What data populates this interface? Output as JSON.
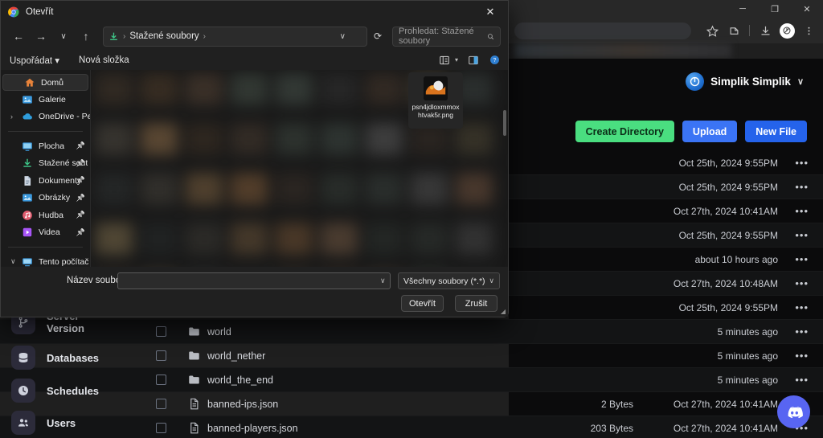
{
  "browser": {
    "window_controls": {
      "minimize": "─",
      "maximize": "❐",
      "close": "✕"
    },
    "toolbar_icons": [
      "bookmark-star-icon",
      "extensions-icon",
      "downloads-icon",
      "profile-icon",
      "chrome-menu-icon"
    ]
  },
  "panel": {
    "user": {
      "name": "Simplik Simplik",
      "chevron": "∨"
    },
    "actions": [
      {
        "label": "Create Directory",
        "color": "#4ade80",
        "text_color": "#0b2d17",
        "name": "create-directory-button"
      },
      {
        "label": "Upload",
        "color": "#3b74f5",
        "text_color": "#ffffff",
        "name": "upload-button"
      },
      {
        "label": "New File",
        "color": "#2563eb",
        "text_color": "#ffffff",
        "name": "new-file-button"
      }
    ],
    "sidebar": [
      {
        "label": "Server Version",
        "icon": "branch-icon"
      },
      {
        "label": "Databases",
        "icon": "database-icon"
      },
      {
        "label": "Schedules",
        "icon": "clock-icon"
      },
      {
        "label": "Users",
        "icon": "users-icon"
      }
    ],
    "files": [
      {
        "name": "",
        "type": "",
        "size": "",
        "modified": "Oct 25th, 2024 9:55PM",
        "menu": "•••"
      },
      {
        "name": "",
        "type": "",
        "size": "",
        "modified": "Oct 25th, 2024 9:55PM",
        "menu": "•••"
      },
      {
        "name": "",
        "type": "",
        "size": "",
        "modified": "Oct 27th, 2024 10:41AM",
        "menu": "•••"
      },
      {
        "name": "",
        "type": "",
        "size": "",
        "modified": "Oct 25th, 2024 9:55PM",
        "menu": "•••"
      },
      {
        "name": "",
        "type": "",
        "size": "",
        "modified": "about 10 hours ago",
        "menu": "•••"
      },
      {
        "name": "",
        "type": "",
        "size": "",
        "modified": "Oct 27th, 2024 10:48AM",
        "menu": "•••"
      },
      {
        "name": "",
        "type": "",
        "size": "",
        "modified": "Oct 25th, 2024 9:55PM",
        "menu": "•••"
      },
      {
        "name": "world",
        "type": "folder",
        "size": "",
        "modified": "5 minutes ago",
        "menu": "•••"
      },
      {
        "name": "world_nether",
        "type": "folder",
        "size": "",
        "modified": "5 minutes ago",
        "menu": "•••"
      },
      {
        "name": "world_the_end",
        "type": "folder",
        "size": "",
        "modified": "5 minutes ago",
        "menu": "•••"
      },
      {
        "name": "banned-ips.json",
        "type": "file",
        "size": "2 Bytes",
        "modified": "Oct 27th, 2024 10:41AM",
        "menu": "•••"
      },
      {
        "name": "banned-players.json",
        "type": "file",
        "size": "203 Bytes",
        "modified": "Oct 27th, 2024 10:41AM",
        "menu": "•••"
      }
    ],
    "discord_widget": "discord-icon"
  },
  "dialog": {
    "title": "Otevřít",
    "close": "✕",
    "nav": {
      "back": "←",
      "forward": "→",
      "recent": "∨",
      "up": "↑",
      "refresh": "⟳"
    },
    "breadcrumb": {
      "icon": "downloads-icon",
      "sep1": "›",
      "location": "Stažené soubory",
      "sep2": "›",
      "caret": "∨"
    },
    "search": {
      "placeholder": "Prohledat: Stažené soubory",
      "icon": "search-icon"
    },
    "commands": [
      {
        "label": "Uspořádat ▾",
        "name": "organize-menu"
      },
      {
        "label": "Nová složka",
        "name": "new-folder-button"
      }
    ],
    "view_icons": [
      "view-options-icon",
      "view-dropdown-caret",
      "preview-pane-icon",
      "help-icon"
    ],
    "sidebar": [
      {
        "label": "Domů",
        "icon": "home-icon",
        "selected": true,
        "pinned": false,
        "expander": ""
      },
      {
        "label": "Galerie",
        "icon": "gallery-icon",
        "selected": false,
        "pinned": false,
        "expander": ""
      },
      {
        "label": "OneDrive - Pers",
        "icon": "onedrive-icon",
        "selected": false,
        "pinned": false,
        "expander": "›"
      },
      {
        "divider": true
      },
      {
        "label": "Plocha",
        "icon": "desktop-icon",
        "selected": false,
        "pinned": true,
        "expander": ""
      },
      {
        "label": "Stažené sout",
        "icon": "downloads-icon",
        "selected": false,
        "pinned": true,
        "expander": ""
      },
      {
        "label": "Dokumenty",
        "icon": "documents-icon",
        "selected": false,
        "pinned": true,
        "expander": ""
      },
      {
        "label": "Obrázky",
        "icon": "pictures-icon",
        "selected": false,
        "pinned": true,
        "expander": ""
      },
      {
        "label": "Hudba",
        "icon": "music-icon",
        "selected": false,
        "pinned": true,
        "expander": ""
      },
      {
        "label": "Videa",
        "icon": "videos-icon",
        "selected": false,
        "pinned": true,
        "expander": ""
      },
      {
        "divider": true
      },
      {
        "label": "Tento počítač",
        "icon": "this-pc-icon",
        "selected": false,
        "pinned": false,
        "expander": "∨"
      }
    ],
    "file_tile": {
      "name": "psn4jdloxmmoxhtvak5r.png",
      "icon": "image-thumbnail"
    },
    "footer": {
      "filename_label": "Název souboru:",
      "filename_value": "",
      "filename_caret": "∨",
      "filter_value": "Všechny soubory (*.*)",
      "filter_caret": "∨",
      "open_button": "Otevřít",
      "cancel_button": "Zrušit"
    }
  }
}
